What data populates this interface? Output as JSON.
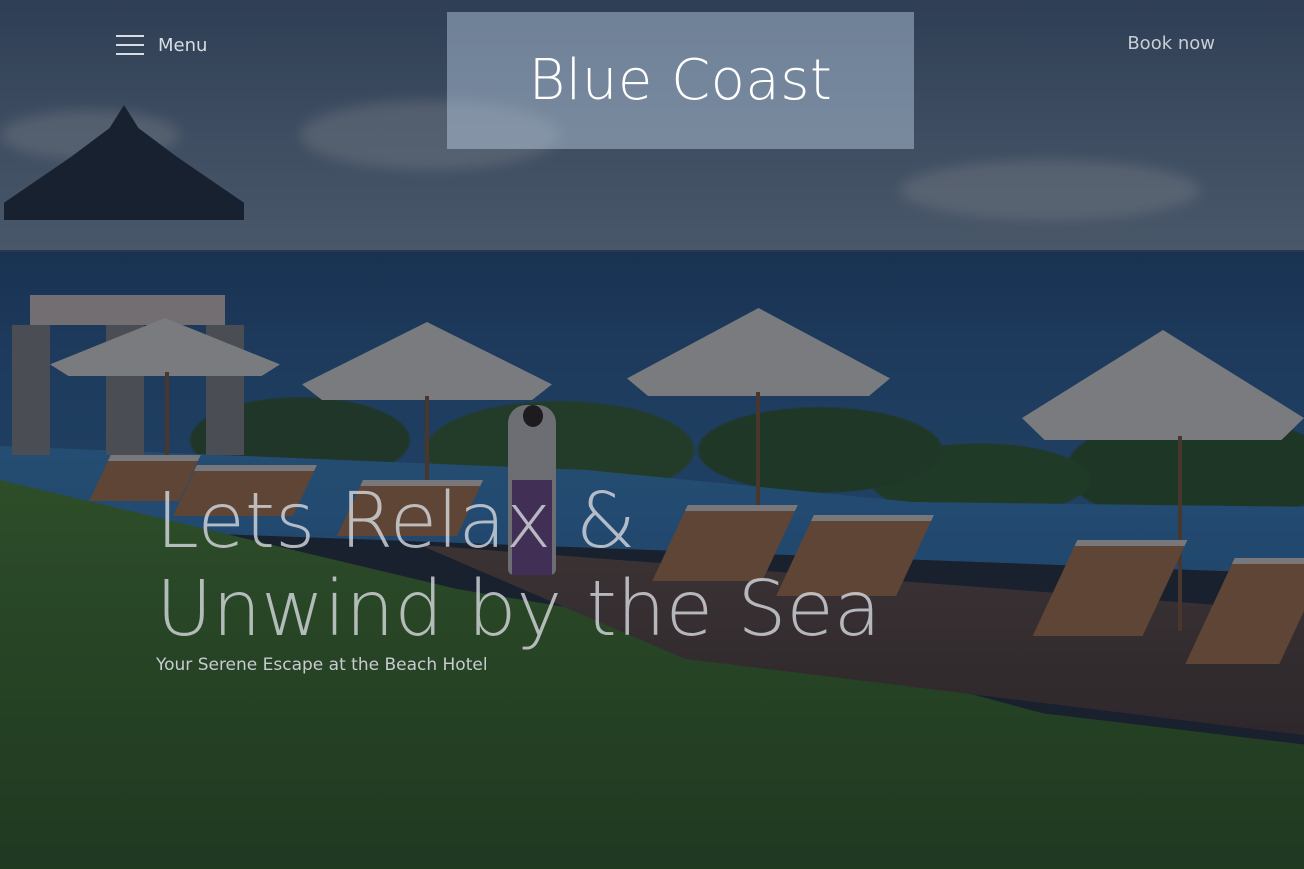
{
  "header": {
    "menu_label": "Menu",
    "logo_text": "Blue Coast",
    "book_label": "Book now"
  },
  "hero": {
    "headline_line1": "Lets Relax &",
    "headline_line2": "Unwind by the Sea",
    "subheadline": "Your Serene Escape at the Beach Hotel",
    "overlay_color": "#141a26"
  },
  "icons": {
    "menu": "hamburger-menu-icon"
  }
}
